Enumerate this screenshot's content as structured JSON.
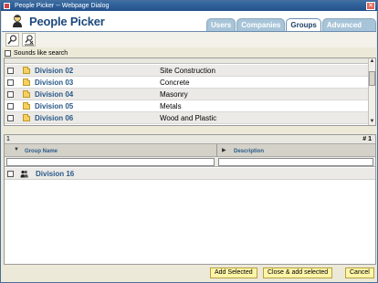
{
  "window": {
    "title": "People Picker -- Webpage Dialog",
    "close_glyph": "✕"
  },
  "header": {
    "title": "People Picker"
  },
  "tabs": [
    {
      "label": "Users"
    },
    {
      "label": "Companies"
    },
    {
      "label": "Groups",
      "active": true
    },
    {
      "label": "Advanced Search"
    }
  ],
  "toolbar": {
    "icons": [
      "search-icon",
      "clear-search-icon"
    ]
  },
  "search": {
    "sounds_like_label": "Sounds like search"
  },
  "results": {
    "rows": [
      {
        "name": "Division 02",
        "description": "Site Construction"
      },
      {
        "name": "Division 03",
        "description": "Concrete"
      },
      {
        "name": "Division 04",
        "description": "Masonry"
      },
      {
        "name": "Division 05",
        "description": "Metals"
      },
      {
        "name": "Division 06",
        "description": "Wood and Plastic"
      }
    ]
  },
  "selected": {
    "count_left": "1",
    "count_right": "# 1",
    "col_group_name": "Group Name",
    "col_description": "Description",
    "rows": [
      {
        "name": "Division 16"
      }
    ]
  },
  "footer": {
    "add_selected": "Add Selected",
    "close_add": "Close & add selected",
    "cancel": "Cancel"
  },
  "colors": {
    "accent": "#1e4a7c",
    "tab": "#a7c4d8",
    "button": "#fff5a8"
  }
}
